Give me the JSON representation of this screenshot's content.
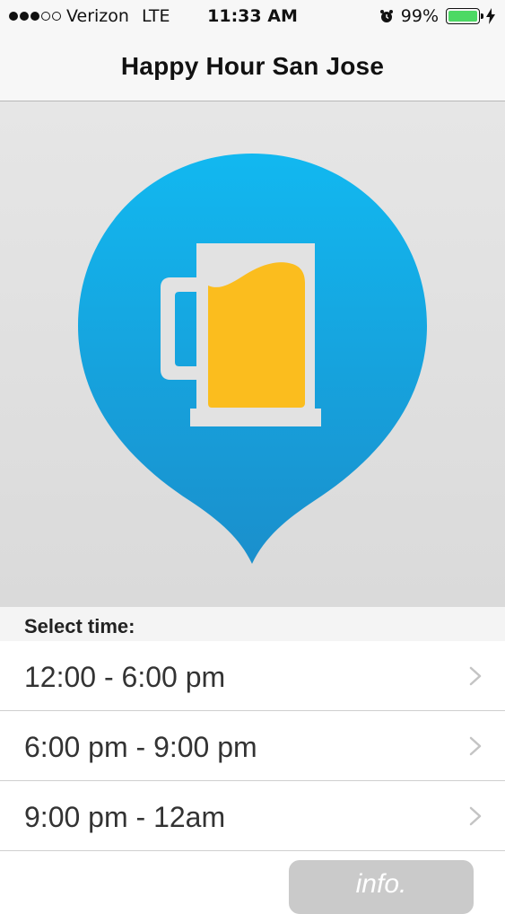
{
  "status_bar": {
    "carrier": "Verizon",
    "network": "LTE",
    "time": "11:33 AM",
    "battery_percent": "99%",
    "battery_level": 0.99,
    "signal_strength": 3,
    "signal_max": 5,
    "icons": [
      "signal-dots",
      "alarm-clock-icon",
      "battery-icon",
      "charging-bolt-icon"
    ]
  },
  "nav": {
    "title": "Happy Hour San Jose"
  },
  "hero": {
    "icon": "beer-mug-map-pin-icon",
    "colors": {
      "pin_top": "#12b8f0",
      "pin_bottom": "#1a8fcc",
      "mug": "#e2e2e2",
      "beer": "#fbbd1e"
    }
  },
  "section": {
    "title": "Select time:"
  },
  "times": [
    {
      "label": "12:00 - 6:00 pm"
    },
    {
      "label": "6:00 pm - 9:00 pm"
    },
    {
      "label": "9:00 pm - 12am"
    }
  ],
  "info_button": {
    "label": "info."
  },
  "colors": {
    "accent": "#12b8f0",
    "battery": "#4cd964"
  }
}
